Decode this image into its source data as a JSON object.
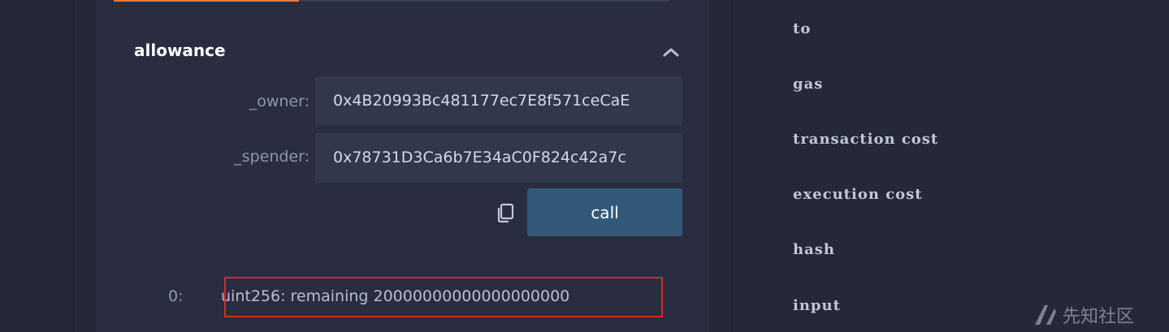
{
  "function_card": {
    "title": "allowance",
    "params": [
      {
        "label": "_owner:",
        "value": "0x4B20993Bc481177ec7E8f571ceCaE"
      },
      {
        "label": "_spender:",
        "value": "0x78731D3Ca6b7E34aC0F824c42a7c"
      }
    ],
    "call_label": "call",
    "result": {
      "index": "0:",
      "value": "uint256: remaining 20000000000000000000"
    }
  },
  "tx_details": {
    "labels": [
      "to",
      "gas",
      "transaction cost",
      "execution cost",
      "hash",
      "input"
    ]
  },
  "watermark": {
    "text": "先知社区"
  },
  "colors": {
    "background": "#252839",
    "card": "#2a2d3f",
    "input_bg": "#33374b",
    "call_button": "#32597a",
    "active_tab": "#e87d3a",
    "highlight": "#d42a2a"
  }
}
